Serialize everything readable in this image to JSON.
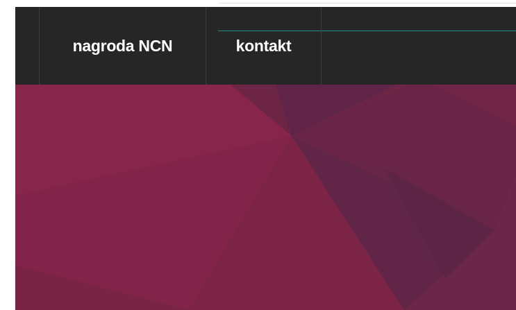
{
  "nav": {
    "items": [
      {
        "label": "nagroda NCN"
      },
      {
        "label": "kontakt"
      }
    ]
  },
  "colors": {
    "navbar_bg": "#262626",
    "nav_text": "#ffffff",
    "nav_accent": "#1d8f8b",
    "hero_red": "#87254a",
    "hero_purple": "#612547"
  }
}
